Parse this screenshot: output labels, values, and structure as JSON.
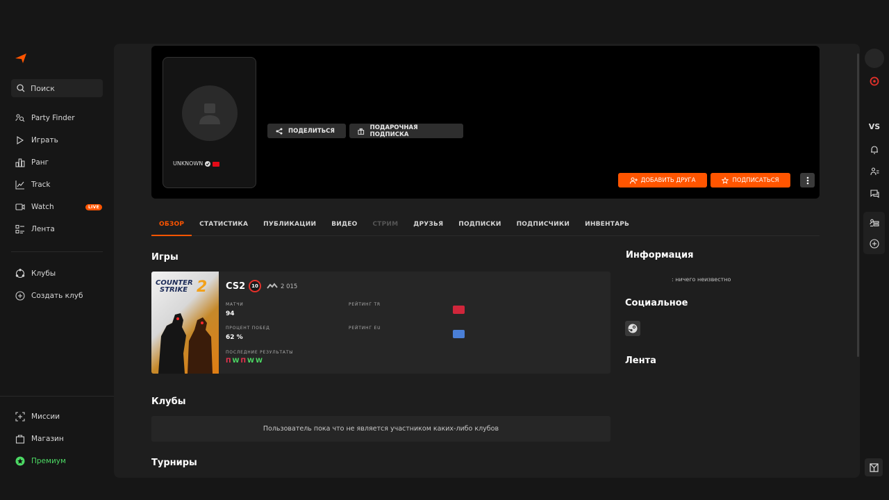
{
  "sidebar": {
    "search_label": "Поиск",
    "items": [
      {
        "label": "Party Finder",
        "icon": "party-finder-icon"
      },
      {
        "label": "Играть",
        "icon": "play-icon"
      },
      {
        "label": "Ранг",
        "icon": "rank-icon"
      },
      {
        "label": "Track",
        "icon": "track-icon"
      },
      {
        "label": "Watch",
        "icon": "watch-icon",
        "badge": "LIVE"
      },
      {
        "label": "Лента",
        "icon": "feed-icon"
      },
      {
        "label": "Клубы",
        "icon": "clubs-icon"
      },
      {
        "label": "Создать клуб",
        "icon": "create-club-icon"
      },
      {
        "label": "Миссии",
        "icon": "missions-icon"
      },
      {
        "label": "Магазин",
        "icon": "shop-icon"
      },
      {
        "label": "Премиум",
        "icon": "premium-icon"
      }
    ]
  },
  "profile": {
    "nickname": "UNKNOWN",
    "buttons": {
      "share": "ПОДЕЛИТЬСЯ",
      "gift": "ПОДАРОЧНАЯ ПОДПИСКА",
      "add_friend": "ДОБАВИТЬ ДРУГА",
      "subscribe": "ПОДПИСАТЬСЯ"
    }
  },
  "tabs": [
    "ОБЗОР",
    "СТАТИСТИКА",
    "ПУБЛИКАЦИИ",
    "ВИДЕО",
    "СТРИМ",
    "ДРУЗЬЯ",
    "ПОДПИСКИ",
    "ПОДПИСЧИКИ",
    "ИНВЕНТАРЬ"
  ],
  "games_section": {
    "title": "Игры",
    "game": {
      "name": "CS2",
      "cover_text_1": "COUNTER",
      "cover_text_2": "STRIKE",
      "cover_number": "2",
      "level": "10",
      "elo": "2 015",
      "matches_label": "МАТЧИ",
      "matches": "94",
      "rating_tr_label": "РЕЙТИНГ TR",
      "winrate_label": "ПРОЦЕНТ ПОБЕД",
      "winrate": "62 %",
      "rating_eu_label": "РЕЙТИНГ EU",
      "recent_label": "ПОСЛЕДНИЕ РЕЗУЛЬТАТЫ",
      "recent": [
        "П",
        "W",
        "П",
        "W",
        "W"
      ]
    }
  },
  "clubs_section": {
    "title": "Клубы",
    "empty_text": "Пользователь пока что не является участником каких-либо клубов"
  },
  "tournaments_section": {
    "title": "Турниры"
  },
  "info_section": {
    "title": "Информация",
    "text": ": ничего неизвестно"
  },
  "social_section": {
    "title": "Социальное"
  },
  "feed_section": {
    "title": "Лента"
  },
  "right_rail": {
    "vs_label": "VS"
  },
  "colors": {
    "accent": "#ff5500",
    "win": "#4cd964",
    "loss": "#e8344e"
  }
}
